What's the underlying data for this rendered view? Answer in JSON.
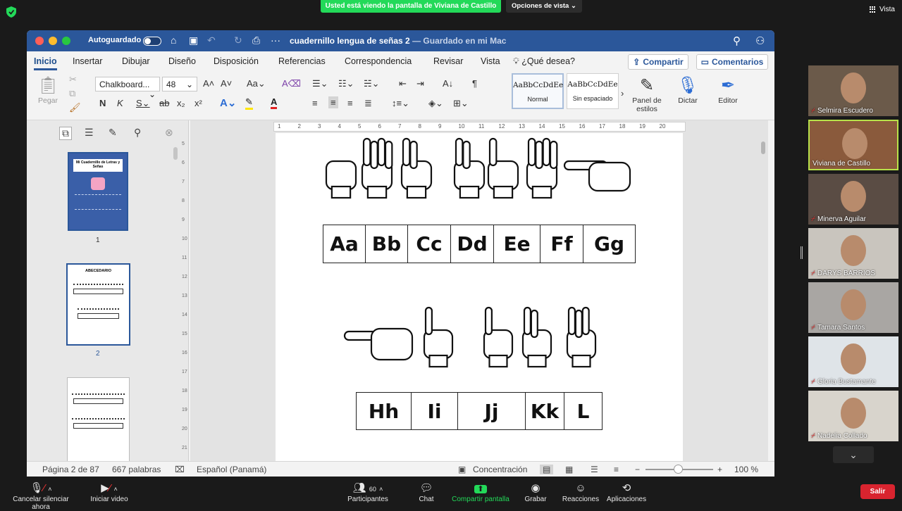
{
  "zoom": {
    "share_banner": "Usted está viendo la pantalla de Viviana de Castillo",
    "view_options": "Opciones de vista",
    "view_label": "Vista",
    "leave": "Salir",
    "bottom": {
      "mute": "Cancelar silenciar ahora",
      "video": "Iniciar video",
      "participants": "Participantes",
      "participants_count": "60",
      "chat": "Chat",
      "share": "Compartir pantalla",
      "record": "Grabar",
      "reactions": "Reacciones",
      "apps": "Aplicaciones"
    },
    "participants": [
      {
        "name": "Selmira Escudero",
        "active": false
      },
      {
        "name": "Viviana de Castillo",
        "active": true
      },
      {
        "name": "Minerva Aguilar",
        "active": false
      },
      {
        "name": "DARYS BARRIOS",
        "active": false
      },
      {
        "name": "Tamara Santos",
        "active": false
      },
      {
        "name": "Gloria Bustamante",
        "active": false
      },
      {
        "name": "Nadelia Collado",
        "active": false
      }
    ]
  },
  "word": {
    "autosave": "Autoguardado",
    "autosave_state": "o",
    "doc_title": "cuadernillo lengua de señas 2",
    "doc_saved": "— Guardado en mi Mac",
    "tabs": [
      "Inicio",
      "Insertar",
      "Dibujar",
      "Diseño",
      "Disposición",
      "Referencias",
      "Correspondencia",
      "Revisar",
      "Vista"
    ],
    "tell_me": "¿Qué desea?",
    "share_btn": "Compartir",
    "comments_btn": "Comentarios",
    "paste": "Pegar",
    "font_name": "Chalkboard...",
    "font_size": "48",
    "styles": [
      {
        "sample": "AaBbCcDdEe",
        "label": "Normal"
      },
      {
        "sample": "AaBbCcDdEe",
        "label": "Sin espaciado"
      }
    ],
    "styles_pane": "Panel de estilos",
    "dictate": "Dictar",
    "editor": "Editor",
    "thumbs": [
      {
        "num": "1",
        "title": "Mi Cuadernillo de Letras y Señas"
      },
      {
        "num": "2",
        "title": "ABECEDARIO"
      }
    ],
    "letters_row1": [
      "Aa",
      "Bb",
      "Cc",
      "Dd",
      "Ee",
      "Ff",
      "Gg"
    ],
    "letters_row2": [
      "Hh",
      "Ii",
      "Jj",
      "Kk",
      "L"
    ],
    "status": {
      "page": "Página 2 de 87",
      "words": "667 palabras",
      "lang": "Español (Panamá)",
      "focus": "Concentración",
      "zoom": "100 %"
    },
    "ruler_ticks": [
      "1",
      "2",
      "3",
      "4",
      "5",
      "6",
      "7",
      "8",
      "9",
      "10",
      "11",
      "12",
      "13",
      "14",
      "15",
      "16",
      "17",
      "18",
      "19",
      "20"
    ],
    "vruler_ticks": [
      "5",
      "6",
      "7",
      "8",
      "9",
      "10",
      "11",
      "12",
      "13",
      "14",
      "15",
      "16",
      "17",
      "18",
      "19",
      "20",
      "21"
    ]
  }
}
